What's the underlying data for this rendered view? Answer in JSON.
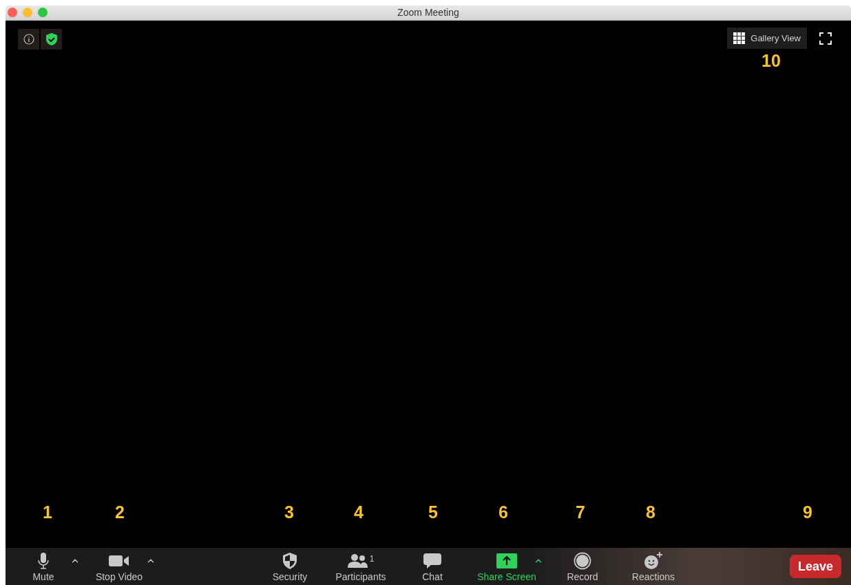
{
  "window": {
    "title": "Zoom Meeting"
  },
  "gallery_view": {
    "label": "Gallery View"
  },
  "toolbar": [
    {
      "kind": "mic",
      "label": "Mute",
      "menu": true,
      "accent": false
    },
    {
      "kind": "video",
      "label": "Stop Video",
      "menu": true,
      "accent": false
    },
    {
      "kind": "security",
      "label": "Security",
      "menu": false,
      "accent": false
    },
    {
      "kind": "participants",
      "label": "Participants",
      "count": "1",
      "menu": false,
      "accent": false
    },
    {
      "kind": "chat",
      "label": "Chat",
      "menu": false,
      "accent": false
    },
    {
      "kind": "share",
      "label": "Share Screen",
      "menu": true,
      "accent": true
    },
    {
      "kind": "record",
      "label": "Record",
      "menu": false,
      "accent": false
    },
    {
      "kind": "reactions",
      "label": "Reactions",
      "menu": false,
      "accent": false
    }
  ],
  "leave_button": {
    "label": "Leave"
  },
  "callouts": [
    "1",
    "2",
    "3",
    "4",
    "5",
    "6",
    "7",
    "8",
    "9"
  ],
  "top_callout": "10"
}
